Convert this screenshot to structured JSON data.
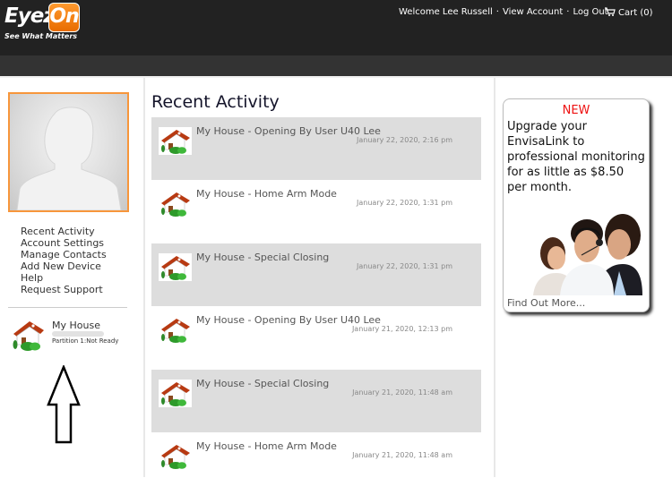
{
  "brand": {
    "logo_part1": "Eyez",
    "logo_part2": "On",
    "tagline": "See What Matters",
    "accent_color": "#f7963b"
  },
  "topnav": {
    "welcome": "Welcome Lee Russell",
    "separator": "·",
    "view_account": "View Account",
    "log_out": "Log Out",
    "cart_label": "Cart (0)",
    "cart_icon": "shopping-cart-icon"
  },
  "sidebar": {
    "avatar_icon": "default-user-silhouette",
    "menu": [
      {
        "label": "Recent Activity"
      },
      {
        "label": "Account Settings"
      },
      {
        "label": "Manage Contacts"
      },
      {
        "label": "Add New Device"
      },
      {
        "label": "Help"
      },
      {
        "label": "Request Support"
      }
    ],
    "device": {
      "name": "My House",
      "status": "Partition 1:Not Ready",
      "icon": "house-icon"
    },
    "annotation_icon": "up-arrow-icon"
  },
  "main": {
    "title": "Recent Activity",
    "activities": [
      {
        "title": "My House - Opening By User U40 Lee",
        "time": "January 22, 2020, 2:16 pm"
      },
      {
        "title": "My House - Home Arm Mode",
        "time": "January 22, 2020, 1:31 pm"
      },
      {
        "title": "My House - Special Closing",
        "time": "January 22, 2020, 1:31 pm"
      },
      {
        "title": "My House - Opening By User U40 Lee",
        "time": "January 21, 2020, 12:13 pm"
      },
      {
        "title": "My House - Special Closing",
        "time": "January 21, 2020, 11:48 am"
      },
      {
        "title": "My House - Home Arm Mode",
        "time": "January 21, 2020, 11:48 am"
      }
    ]
  },
  "ad": {
    "badge": "NEW",
    "text": "Upgrade your EnvisaLink to professional monitoring for as little as $8.50 per month.",
    "link": "Find Out More...",
    "badge_color": "#ee1111"
  }
}
